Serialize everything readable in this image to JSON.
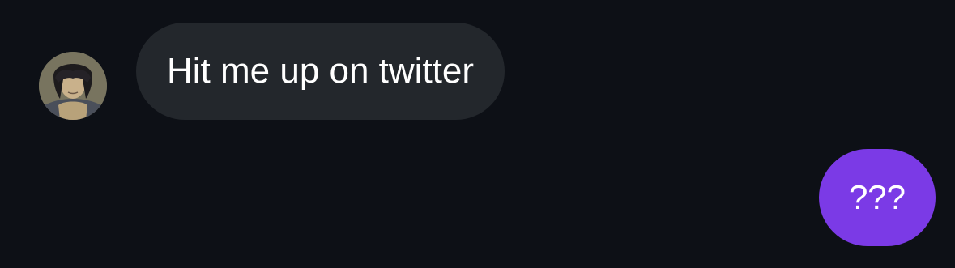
{
  "colors": {
    "background": "#0d1016",
    "incoming_bubble": "#23272c",
    "outgoing_bubble": "#7b3ae6",
    "text": "#ffffff"
  },
  "messages": [
    {
      "direction": "incoming",
      "text": "Hit me up on twitter",
      "avatar_icon": "user-avatar"
    },
    {
      "direction": "outgoing",
      "text": "???"
    }
  ]
}
